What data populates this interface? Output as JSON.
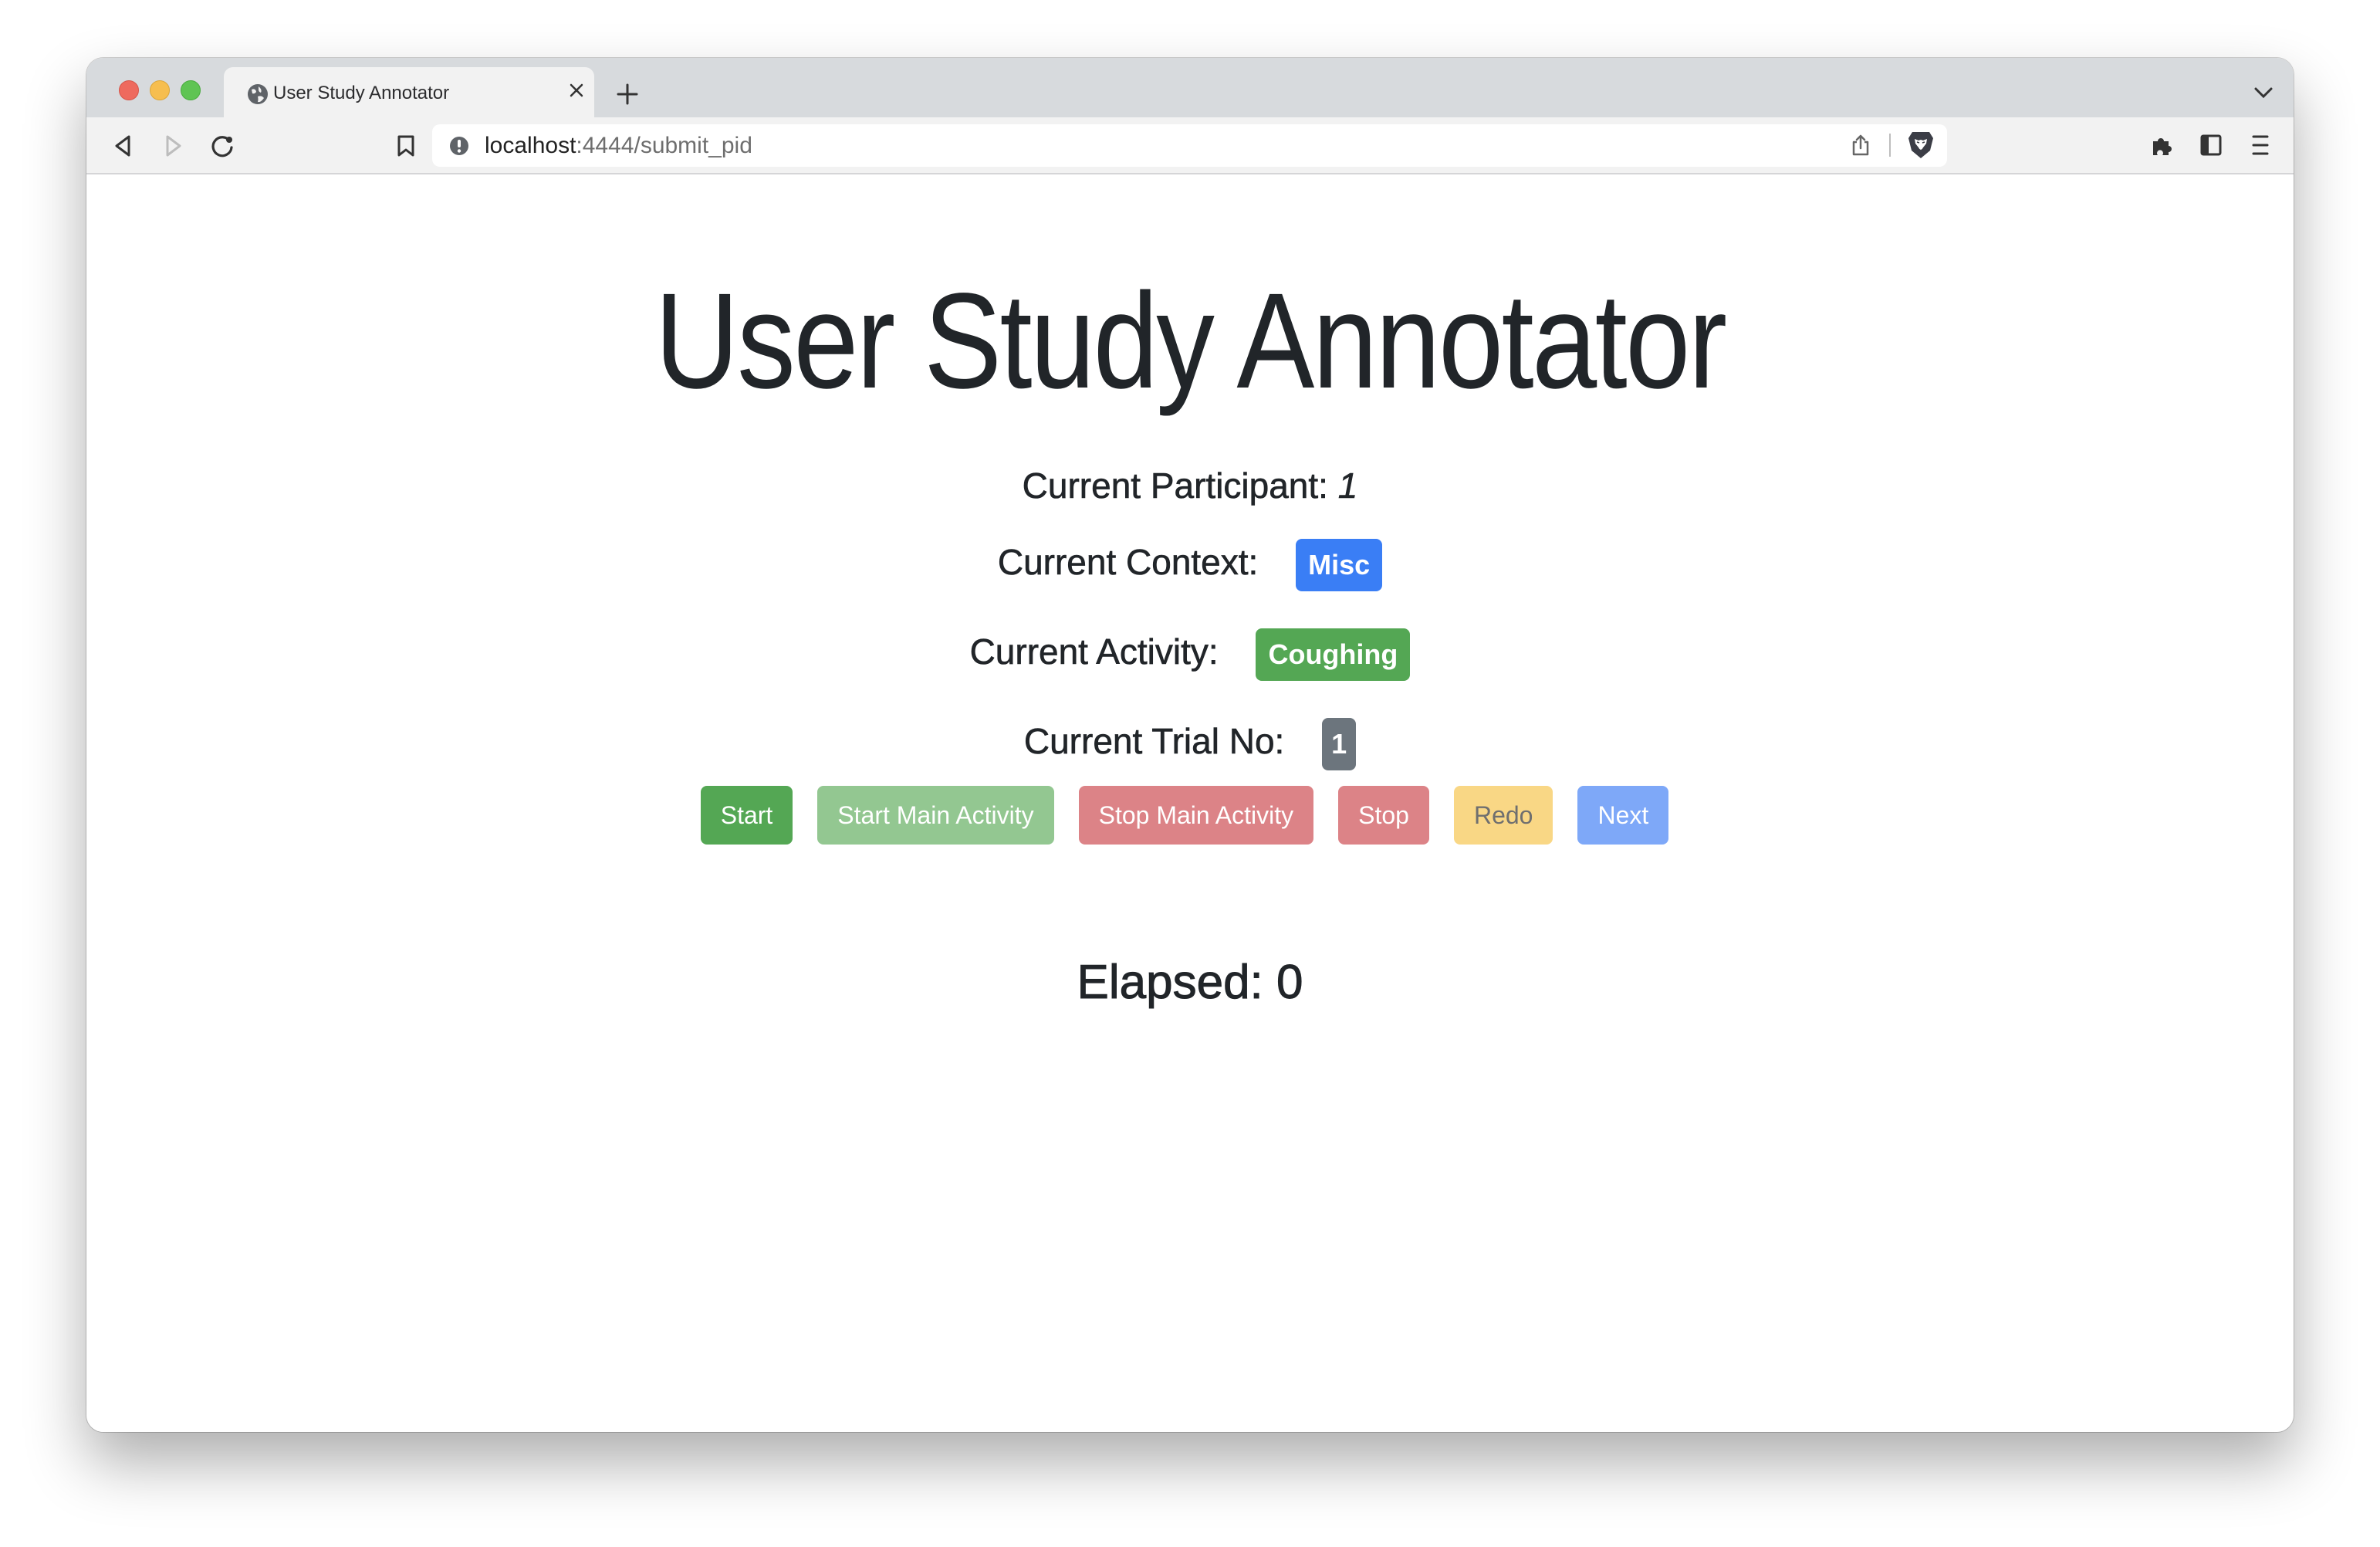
{
  "browser": {
    "tab_title": "User Study Annotator",
    "url_host": "localhost",
    "url_rest": ":4444/submit_pid",
    "icons": {
      "tab_favicon": "globe-icon",
      "tab_close": "close-icon",
      "new_tab": "plus-icon",
      "tab_list": "chevron-down-icon",
      "back": "back-icon",
      "forward": "forward-icon",
      "reload": "reload-icon",
      "bookmark": "bookmark-icon",
      "site_info": "info-icon",
      "share": "share-icon",
      "shields": "brave-shields-icon",
      "extensions": "puzzle-icon",
      "sidebar": "sidebar-icon",
      "menu": "menu-icon"
    }
  },
  "page": {
    "title": "User Study Annotator",
    "participant_label": "Current Participant:",
    "participant_value": "1",
    "context_label": "Current Context:",
    "context_value": "Misc",
    "activity_label": "Current Activity:",
    "activity_value": "Coughing",
    "trial_label": "Current Trial No:",
    "trial_value": "1",
    "buttons": {
      "start": "Start",
      "start_main": "Start Main Activity",
      "stop_main": "Stop Main Activity",
      "stop": "Stop",
      "redo": "Redo",
      "next": "Next"
    },
    "elapsed_label": "Elapsed:",
    "elapsed_value": "0"
  },
  "colors": {
    "context_badge": "#3a7ef5",
    "activity_badge": "#54a754",
    "trial_badge": "#6c757d",
    "start": "#54a754",
    "start_main_disabled": "#93c791",
    "stop_disabled": "#dc8387",
    "redo": "#f9d785",
    "next": "#7ea8f8"
  }
}
